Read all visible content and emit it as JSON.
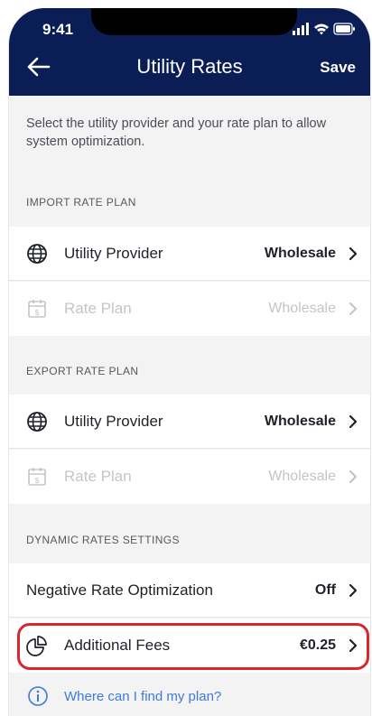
{
  "status_bar": {
    "time": "9:41"
  },
  "nav": {
    "title": "Utility Rates",
    "save_label": "Save"
  },
  "intro_text": "Select the utility provider and your rate plan to allow system optimization.",
  "import_section": {
    "label": "IMPORT RATE PLAN",
    "provider": {
      "label": "Utility Provider",
      "value": "Wholesale"
    },
    "plan": {
      "label": "Rate Plan",
      "value": "Wholesale"
    }
  },
  "export_section": {
    "label": "EXPORT RATE PLAN",
    "provider": {
      "label": "Utility Provider",
      "value": "Wholesale"
    },
    "plan": {
      "label": "Rate Plan",
      "value": "Wholesale"
    }
  },
  "dynamic_section": {
    "label": "DYNAMIC RATES SETTINGS",
    "negative": {
      "label": "Negative Rate Optimization",
      "value": "Off"
    },
    "fees": {
      "label": "Additional Fees",
      "value": "€0.25"
    }
  },
  "help": {
    "label": "Where can I find my plan?"
  },
  "colors": {
    "header": "#0a1e55",
    "highlight": "#d8262f",
    "link": "#3e7bd6",
    "disabled": "#c4c5ca"
  }
}
